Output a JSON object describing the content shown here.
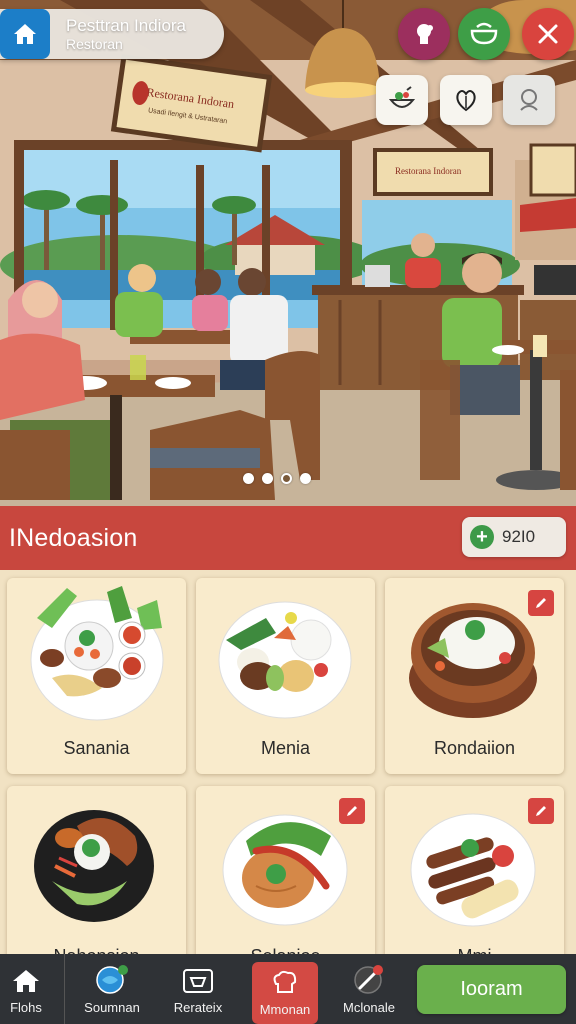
{
  "header": {
    "title": "Pesttran Indiora",
    "subtitle": "Restoran"
  },
  "top_actions": [
    {
      "icon": "chef-icon",
      "color": "#9c2f5e"
    },
    {
      "icon": "bowl-icon",
      "color": "#3e9e47"
    },
    {
      "icon": "close-icon",
      "color": "#d9443e"
    }
  ],
  "quick_actions": [
    {
      "icon": "salad-icon"
    },
    {
      "icon": "leaf-icon"
    },
    {
      "icon": "search-icon"
    }
  ],
  "hero": {
    "sign_main": "Restorana Indoran",
    "sign_main_sub": "Usadi Ilengit & Ustrataran",
    "sign_side": "Restorana Indoran",
    "carousel_dots": 4,
    "active_dot": 2
  },
  "section": {
    "title": "INedoasion",
    "count_label": "92I0"
  },
  "menu_items": [
    {
      "name": "Sanania",
      "editable": false
    },
    {
      "name": "Menia",
      "editable": false
    },
    {
      "name": "Rondaiion",
      "editable": true
    },
    {
      "name": "Nahonsion",
      "editable": false
    },
    {
      "name": "Selanioe",
      "editable": true
    },
    {
      "name": "Mmi",
      "editable": true
    }
  ],
  "bottom_nav": {
    "items": [
      {
        "label": "Flohs",
        "icon": "home-icon"
      },
      {
        "label": "Soumnan",
        "icon": "globe-icon"
      },
      {
        "label": "Rerateix",
        "icon": "calendar-icon"
      },
      {
        "label": "Mmonan",
        "icon": "chef-hat-icon"
      },
      {
        "label": "Mclonale",
        "icon": "pen-icon"
      }
    ],
    "active_index": 3,
    "cta_label": "Iooram"
  },
  "colors": {
    "primary_red": "#c8473e",
    "home_blue": "#1c7ec8",
    "cta_green": "#6ab04c",
    "nav_bg": "#2f3236",
    "card_bg": "#f9ebcc"
  }
}
